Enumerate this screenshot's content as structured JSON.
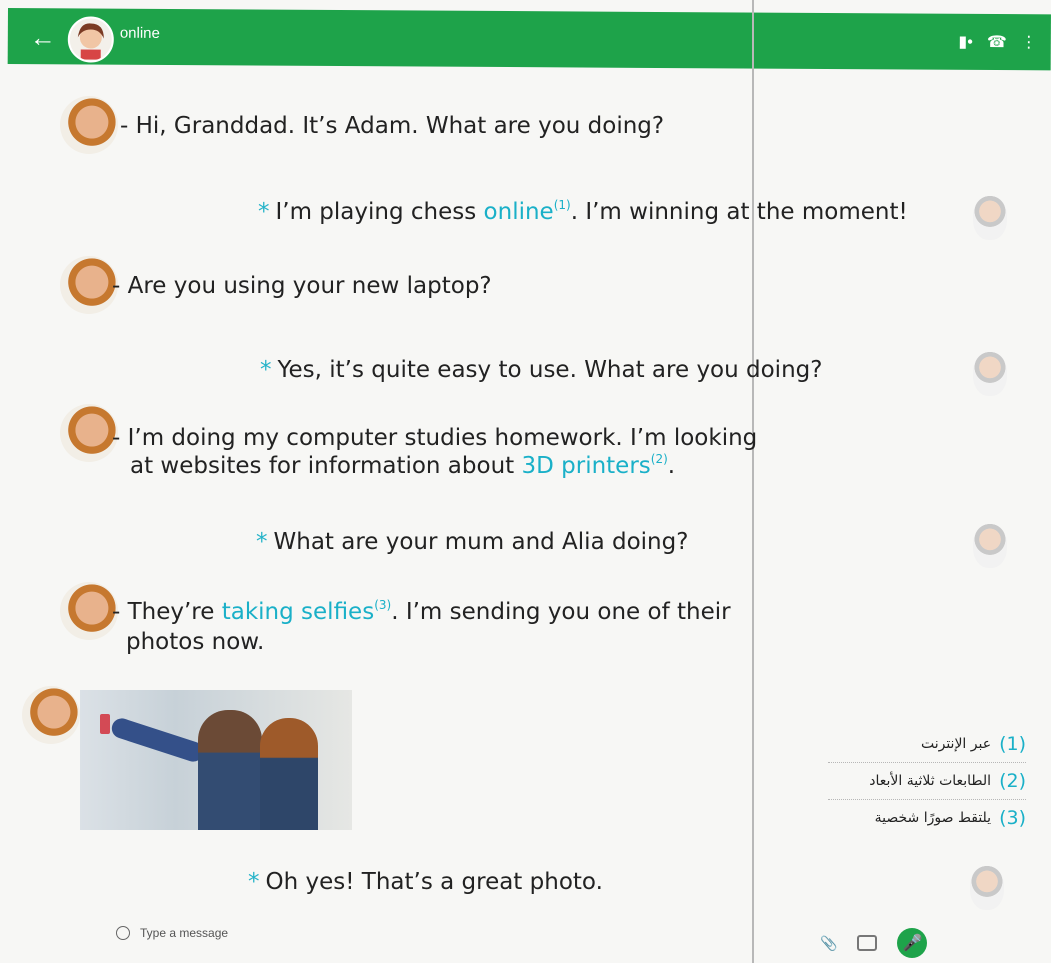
{
  "header": {
    "status": "online",
    "icons": [
      "back-arrow-icon",
      "video-icon",
      "phone-icon",
      "menu-icon"
    ]
  },
  "messages": [
    {
      "text": "- Hi, Granddad. It’s Adam. What are you doing?"
    },
    {
      "text_before": "I’m playing chess ",
      "highlight": "online",
      "sup": "(1)",
      "text_after": ". I’m winning at the moment!"
    },
    {
      "text": "- Are you using your new laptop?"
    },
    {
      "text": "Yes, it’s quite easy to use. What are you doing?"
    },
    {
      "line1": "- I’m doing my computer studies homework. I’m looking",
      "line2_before": "at websites for information about ",
      "highlight": "3D printers",
      "sup": "(2)",
      "text_after": "."
    },
    {
      "text": "What are your mum and Alia doing?"
    },
    {
      "line1_before": "- They’re ",
      "highlight": "taking selfies",
      "sup": "(3)",
      "line1_after": ". I’m sending you one of their",
      "line2": "photos now."
    },
    {
      "text": "Oh yes! That’s a great photo."
    }
  ],
  "glossary": [
    {
      "num": "(1)",
      "text": "عبر الإنترنت"
    },
    {
      "num": "(2)",
      "text": "الطابعات ثلاثية الأبعاد"
    },
    {
      "num": "(3)",
      "text": "يلتقط صورًا شخصية"
    }
  ],
  "input": {
    "placeholder": "Type a message"
  },
  "colors": {
    "header_green": "#1ea34a",
    "highlight_blue": "#1ab0c8",
    "mic_green": "#1ea34a"
  }
}
